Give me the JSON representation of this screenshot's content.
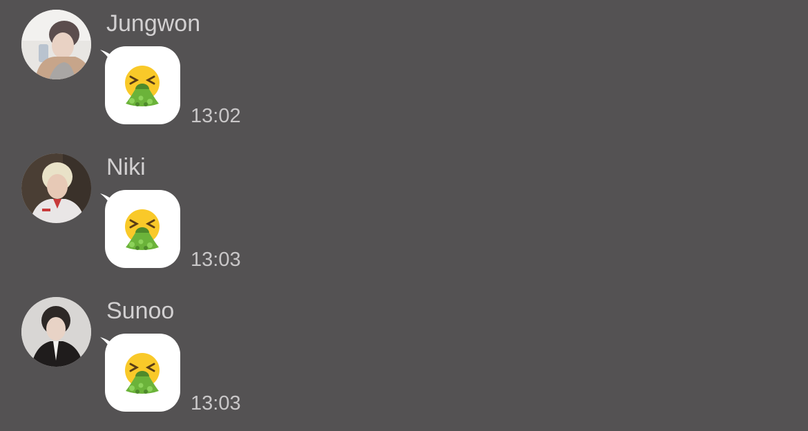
{
  "messages": [
    {
      "sender": "Jungwon",
      "avatar_icon": "profile-photo-icon",
      "content_icon": "vomiting-face-emoji-icon",
      "time": "13:02"
    },
    {
      "sender": "Niki",
      "avatar_icon": "profile-photo-icon",
      "content_icon": "vomiting-face-emoji-icon",
      "time": "13:03"
    },
    {
      "sender": "Sunoo",
      "avatar_icon": "profile-photo-icon",
      "content_icon": "vomiting-face-emoji-icon",
      "time": "13:03"
    }
  ],
  "colors": {
    "background": "#545253",
    "bubble": "#ffffff",
    "sender_text": "#d2d0d1",
    "time_text": "#c9c7c8",
    "emoji_face": "#f9c929",
    "emoji_vomit": "#6bb33a"
  }
}
